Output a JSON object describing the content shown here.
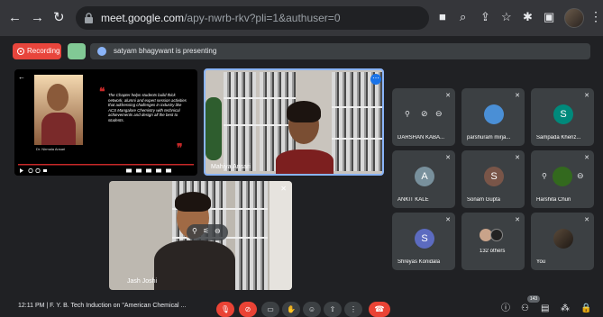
{
  "browser": {
    "url_host": "meet.google.com",
    "url_path": "/apy-nwrb-rkv?pli=1&authuser=0"
  },
  "meet_header": {
    "recording_label": "Recording",
    "presenting_text": "satyam bhagywant is presenting"
  },
  "presentation": {
    "caption": "Dr. Nirmala Ansari",
    "quote": "The Chapter helps students build thick network, alumni and expert session activities that addressing challenges in industry like ACS Mangalore Chemistry with technical achievements and design all the best to students."
  },
  "video_tiles": [
    {
      "name": "Mahiya Ansari"
    },
    {
      "name": "Jash Joshi"
    }
  ],
  "participants": [
    {
      "name": "DARSHAN KABA...",
      "initial": "",
      "color": "#3c4043"
    },
    {
      "name": "parshuram mirja...",
      "initial": "",
      "color": "#4a8fd6"
    },
    {
      "name": "Sampada Khenz...",
      "initial": "S",
      "color": "#00897b"
    },
    {
      "name": "ANKIT KALE",
      "initial": "A",
      "color": "#78909c"
    },
    {
      "name": "Sonam Gupta",
      "initial": "S",
      "color": "#795548"
    },
    {
      "name": "Harshita Churi",
      "initial": "",
      "color": "#33691e"
    },
    {
      "name": "Shreyas Konidala",
      "initial": "S",
      "color": "#5c6bc0"
    },
    {
      "name": "132 others",
      "initial": "",
      "color": "#3c4043"
    },
    {
      "name": "You",
      "initial": "",
      "color": "#3c4043"
    }
  ],
  "bottom_bar": {
    "time": "12:11 PM",
    "meeting_title": "F. Y. B. Tech Induction on \"American Chemical ...",
    "participant_count": "143"
  },
  "colors": {
    "accent": "#1a73e8",
    "danger": "#ea4335",
    "surface": "#3c4043",
    "background": "#202124"
  }
}
